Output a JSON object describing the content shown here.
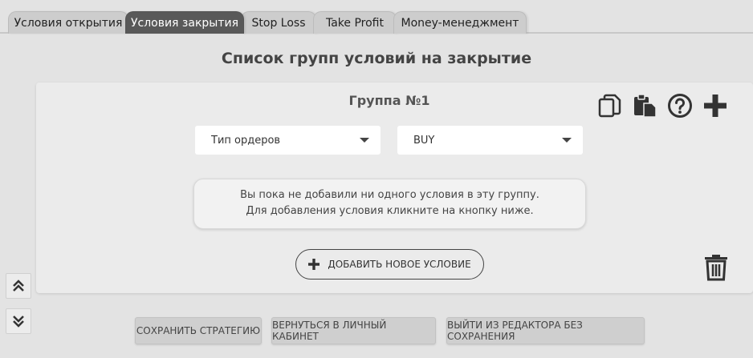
{
  "tabs": [
    {
      "label": "Условия открытия",
      "active": false
    },
    {
      "label": "Условия закрытия",
      "active": true
    },
    {
      "label": "Stop Loss",
      "active": false
    },
    {
      "label": "Take Profit",
      "active": false
    },
    {
      "label": "Money-менеджмент",
      "active": false
    }
  ],
  "page_title": "Список групп условий на закрытие",
  "group": {
    "title": "Группа №1",
    "icons": [
      "copy-icon",
      "paste-icon",
      "help-icon",
      "plus-icon"
    ],
    "order_type_select": {
      "value": "Тип ордеров"
    },
    "direction_select": {
      "value": "BUY"
    },
    "notice_line1": "Вы пока не добавили ни одного условия в эту группу.",
    "notice_line2": "Для добавления условия кликните на кнопку ниже.",
    "add_condition_label": "ДОБАВИТЬ НОВОЕ УСЛОВИЕ"
  },
  "nav": {
    "up_icon": "double-chevron-up-icon",
    "down_icon": "double-chevron-down-icon"
  },
  "bottom": {
    "save_label": "СОХРАНИТЬ СТРАТЕГИЮ",
    "back_label": "ВЕРНУТЬСЯ В ЛИЧНЫЙ КАБИНЕТ",
    "exit_label": "ВЫЙТИ ИЗ РЕДАКТОРА БЕЗ СОХРАНЕНИЯ"
  },
  "colors": {
    "active_tab": "#595959",
    "tab": "#cdcdcd",
    "background": "#e3e3e3",
    "card": "#ebebeb"
  }
}
